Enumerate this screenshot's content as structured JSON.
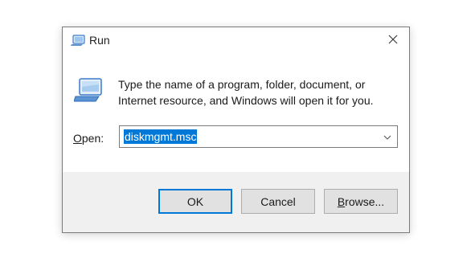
{
  "window": {
    "title": "Run",
    "title_icon": "run-icon",
    "close_icon": "close-icon"
  },
  "content": {
    "icon": "run-icon",
    "description": "Type the name of a program, folder, document, or Internet resource, and Windows will open it for you."
  },
  "open_field": {
    "label_accel": "O",
    "label_rest": "pen:",
    "value": "diskmgmt.msc",
    "dropdown_icon": "chevron-down-icon"
  },
  "buttons": {
    "ok": "OK",
    "cancel": "Cancel",
    "browse_accel": "B",
    "browse_rest": "rowse..."
  },
  "colors": {
    "accent": "#0078d7",
    "footer_bg": "#f0f0f0",
    "button_bg": "#e1e1e1"
  }
}
